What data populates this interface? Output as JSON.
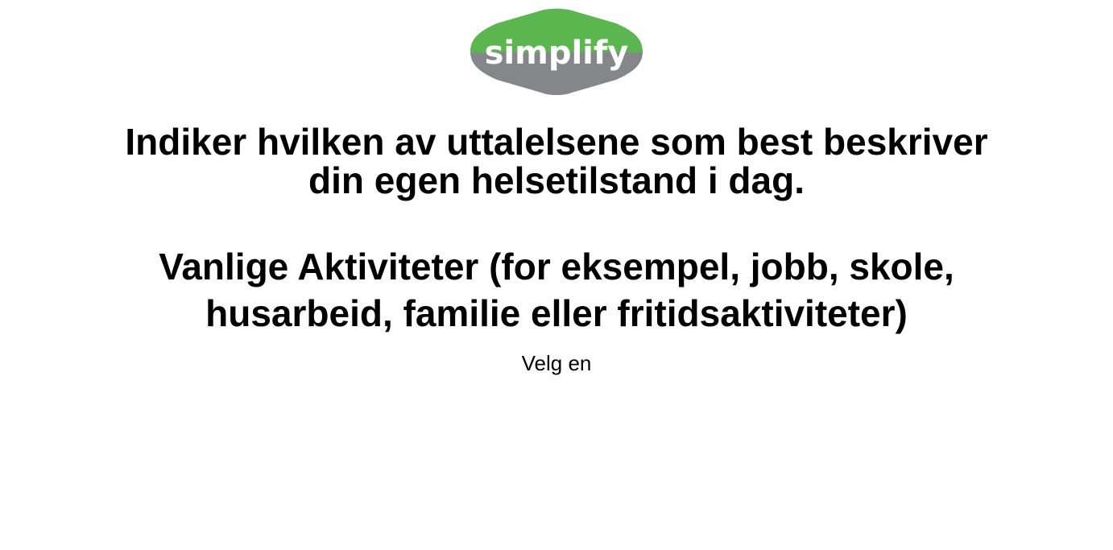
{
  "brand": {
    "logo_text": "simplify",
    "colors": {
      "green": "#5cb64f",
      "gray": "#85868a",
      "text": "#ffffff"
    }
  },
  "question": {
    "instruction_line1": "Indiker hvilken av uttalelsene som best beskriver",
    "instruction_line2": "din egen helsetilstand i dag.",
    "category_line1": "Vanlige Aktiviteter (for eksempel, jobb, skole,",
    "category_line2": "husarbeid, familie eller fritidsaktiviteter)",
    "hint": "Velg en"
  }
}
